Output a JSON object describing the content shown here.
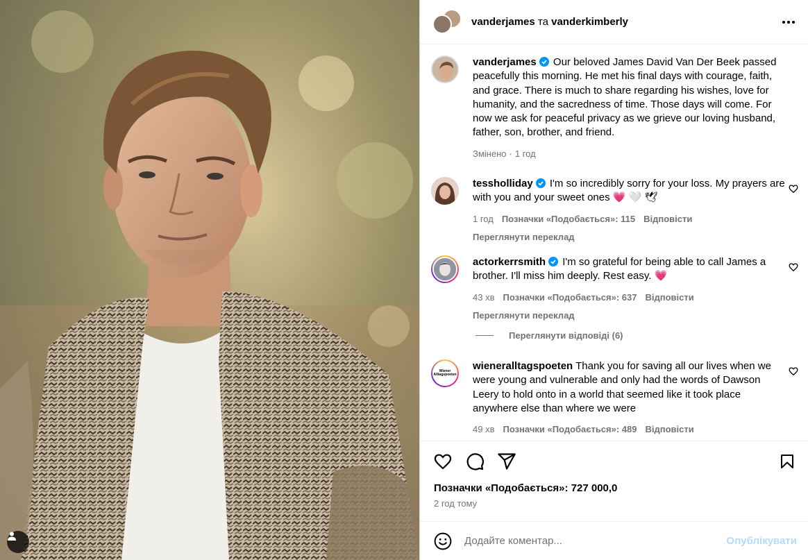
{
  "header": {
    "author": "vanderjames",
    "joiner": "та",
    "coauthor": "vanderkimberly",
    "more_icon": "more-horizontal-icon"
  },
  "caption": {
    "username": "vanderjames",
    "text": "Our beloved James David Van Der Beek passed peacefully this morning. He met his final days with courage, faith, and grace. There is much to share regarding his wishes, love for humanity, and the sacredness of time. Those days will come. For now we ask for peaceful privacy as we grieve our loving husband, father, son, brother, and friend.",
    "edited": "Змінено",
    "time": "1 год"
  },
  "comments": [
    {
      "username": "tessholliday",
      "verified": true,
      "text": "I'm so incredibly sorry for your loss. My prayers are with you and your sweet ones",
      "emoji": "💗 🤍 🕊",
      "time": "1 год",
      "likes": "Позначки «Подобається»: 115",
      "reply": "Відповісти",
      "translate": "Переглянути переклад"
    },
    {
      "username": "actorkerrsmith",
      "verified": true,
      "text": "I'm so grateful for being able to call James a brother. I'll miss him deeply. Rest easy.",
      "emoji": "💗",
      "time": "43 хв",
      "likes": "Позначки «Подобається»: 637",
      "reply": "Відповісти",
      "translate": "Переглянути переклад",
      "view_replies": "Переглянути відповіді (6)"
    },
    {
      "username": "wieneralltagspoeten",
      "verified": false,
      "text": "Thank you for saving all our lives when we were young and vulnerable and only had the words of Dawson Leery to hold onto in a world that seemed like it took place anywhere else than where we were",
      "time": "49 хв",
      "likes": "Позначки «Подобається»: 489",
      "reply": "Відповісти",
      "avatar_text": "Wiener Alltagspoeten"
    }
  ],
  "actions": {
    "like_icon": "heart-icon",
    "comment_icon": "comment-icon",
    "share_icon": "send-icon",
    "save_icon": "bookmark-icon"
  },
  "likes_total": "Позначки «Подобається»: 727 000,0",
  "posted": "2 год тому",
  "comment_input": {
    "placeholder": "Додайте коментар...",
    "submit": "Опублікувати"
  },
  "colors": {
    "verified": "#0095f6",
    "muted": "#737373",
    "submit_disabled": "#b3dbff",
    "heart": "#e8336a"
  }
}
